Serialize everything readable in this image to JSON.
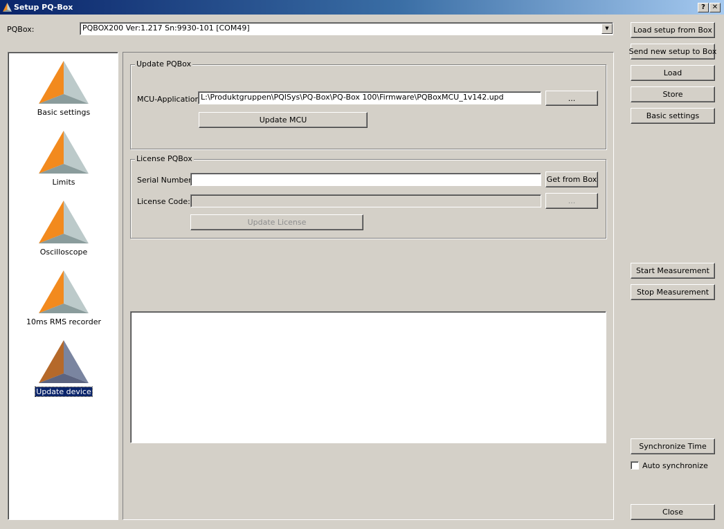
{
  "window": {
    "title": "Setup PQ-Box",
    "help_label": "?",
    "close_label": "✕"
  },
  "device": {
    "label": "PQBox:",
    "selected": "PQBOX200 Ver:1.217 Sn:9930-101 [COM49]"
  },
  "nav": {
    "items": [
      {
        "label": "Basic settings"
      },
      {
        "label": "Limits"
      },
      {
        "label": "Oscilloscope"
      },
      {
        "label": "10ms RMS recorder"
      },
      {
        "label": "Update device"
      }
    ]
  },
  "update_group": {
    "title": "Update PQBox",
    "mcu_label": "MCU-Application:",
    "mcu_value": "L:\\Produktgruppen\\PQISys\\PQ-Box\\PQ-Box 100\\Firmware\\PQBoxMCU_1v142.upd",
    "browse_label": "...",
    "update_button": "Update MCU"
  },
  "license_group": {
    "title": "License PQBox",
    "serial_label": "Serial Number:",
    "serial_value": "",
    "get_button": "Get from Box",
    "license_label": "License Code:",
    "license_value": "",
    "browse_label": "...",
    "update_button": "Update License"
  },
  "sidebar": {
    "load_from_box": "Load setup from Box",
    "send_to_box": "Send new setup to Box",
    "load": "Load",
    "store": "Store",
    "basic_settings": "Basic settings",
    "start_measurement": "Start Measurement",
    "stop_measurement": "Stop Measurement",
    "sync_time": "Synchronize Time",
    "auto_sync_label": "Auto synchronize",
    "auto_sync_checked": false,
    "close": "Close"
  },
  "colors": {
    "accent_orange": "#f28a1e",
    "selected_bg": "#0a246a",
    "face": "#d4d0c8"
  }
}
